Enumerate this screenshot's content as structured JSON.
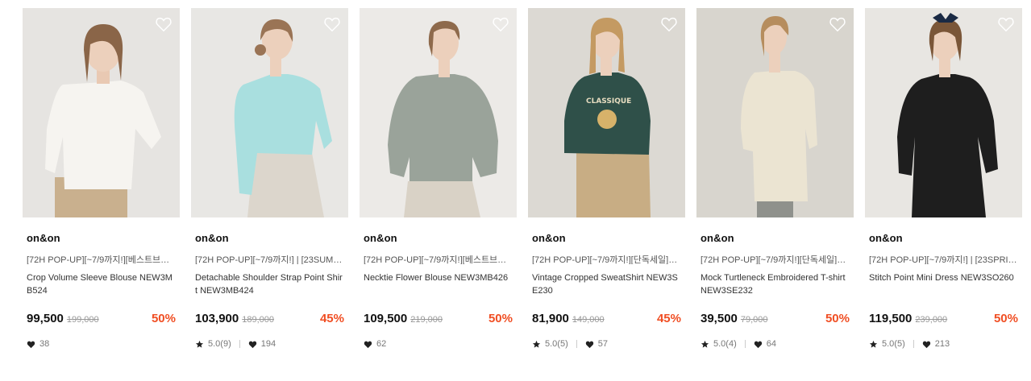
{
  "products": [
    {
      "brand": "on&on",
      "promo": "[72H POP-UP][~7/9까지!][베스트브…",
      "name": "Crop Volume Sleeve Blouse NEW3MB524",
      "price": "99,500",
      "original_price": "199,000",
      "discount": "50%",
      "rating": "",
      "likes": "38",
      "icons": {
        "wishlist": "heart-outline-icon",
        "like": "heart-filled-icon",
        "star": "star-icon"
      }
    },
    {
      "brand": "on&on",
      "promo": "[72H POP-UP][~7/9까지!] | [23SUM…",
      "name": "Detachable Shoulder Strap Point Shirt NEW3MB424",
      "price": "103,900",
      "original_price": "189,000",
      "discount": "45%",
      "rating": "5.0(9)",
      "likes": "194",
      "icons": {
        "wishlist": "heart-outline-icon",
        "like": "heart-filled-icon",
        "star": "star-icon"
      }
    },
    {
      "brand": "on&on",
      "promo": "[72H POP-UP][~7/9까지!][베스트브…",
      "name": "Necktie Flower Blouse NEW3MB426",
      "price": "109,500",
      "original_price": "219,000",
      "discount": "50%",
      "rating": "",
      "likes": "62",
      "icons": {
        "wishlist": "heart-outline-icon",
        "like": "heart-filled-icon",
        "star": "star-icon"
      }
    },
    {
      "brand": "on&on",
      "promo": "[72H POP-UP][~7/9까지!][단독세일]…",
      "name": "Vintage Cropped SweatShirt NEW3SE230",
      "price": "81,900",
      "original_price": "149,000",
      "discount": "45%",
      "rating": "5.0(5)",
      "likes": "57",
      "icons": {
        "wishlist": "heart-outline-icon",
        "like": "heart-filled-icon",
        "star": "star-icon"
      }
    },
    {
      "brand": "on&on",
      "promo": "[72H POP-UP][~7/9까지!][단독세일]…",
      "name": "Mock Turtleneck Embroidered T-shirt NEW3SE232",
      "price": "39,500",
      "original_price": "79,000",
      "discount": "50%",
      "rating": "5.0(4)",
      "likes": "64",
      "icons": {
        "wishlist": "heart-outline-icon",
        "like": "heart-filled-icon",
        "star": "star-icon"
      }
    },
    {
      "brand": "on&on",
      "promo": "[72H POP-UP][~7/9까지!] | [23SPRI…",
      "name": "Stitch Point Mini Dress NEW3SO260",
      "price": "119,500",
      "original_price": "239,000",
      "discount": "50%",
      "rating": "5.0(5)",
      "likes": "213",
      "icons": {
        "wishlist": "heart-outline-icon",
        "like": "heart-filled-icon",
        "star": "star-icon"
      }
    }
  ],
  "colors": {
    "discount": "#f04e23",
    "original_price": "#999999",
    "brand_text": "#111111",
    "photo_backgrounds": [
      "#e6e4e1",
      "#e8e7e4",
      "#eceae7",
      "#dcd9d3",
      "#d8d5ce",
      "#e8e6e2"
    ],
    "garments": [
      "#f4f2ee",
      "#a9dfdf",
      "#9aa39a",
      "#2f5049",
      "#ebe4d2",
      "#1e1e1e"
    ]
  }
}
